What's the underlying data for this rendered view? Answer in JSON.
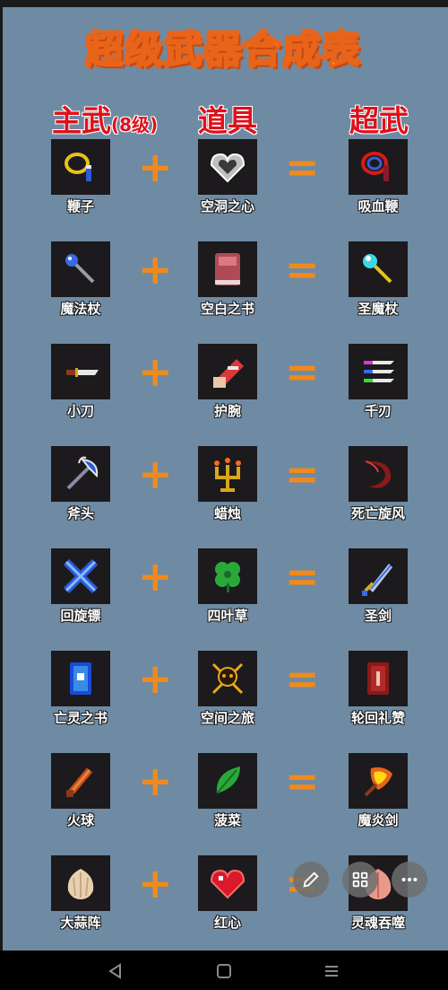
{
  "title": "超级武器合成表",
  "headers": {
    "main": "主武",
    "main_sub": "(8级)",
    "item": "道具",
    "super": "超武"
  },
  "operators": {
    "plus": "+",
    "equals": "="
  },
  "recipes": [
    {
      "weapon": "鞭子",
      "item": "空洞之心",
      "result": "吸血鞭"
    },
    {
      "weapon": "魔法杖",
      "item": "空白之书",
      "result": "圣魔杖"
    },
    {
      "weapon": "小刀",
      "item": "护腕",
      "result": "千刃"
    },
    {
      "weapon": "斧头",
      "item": "蜡烛",
      "result": "死亡旋风"
    },
    {
      "weapon": "回旋镖",
      "item": "四叶草",
      "result": "圣剑"
    },
    {
      "weapon": "亡灵之书",
      "item": "空间之旅",
      "result": "轮回礼赞"
    },
    {
      "weapon": "火球",
      "item": "菠菜",
      "result": "魔炎剑"
    },
    {
      "weapon": "大蒜阵",
      "item": "红心",
      "result": "灵魂吞噬"
    }
  ],
  "colors": {
    "background": "#6f8aa3",
    "header_red": "#e0101a",
    "operator_orange": "#f08a1c",
    "title_stroke": "#e8641a"
  },
  "icons": {
    "fab": [
      "pencil-icon",
      "grid-icon",
      "more-icon"
    ],
    "nav": [
      "back-icon",
      "home-icon",
      "menu-icon"
    ]
  }
}
